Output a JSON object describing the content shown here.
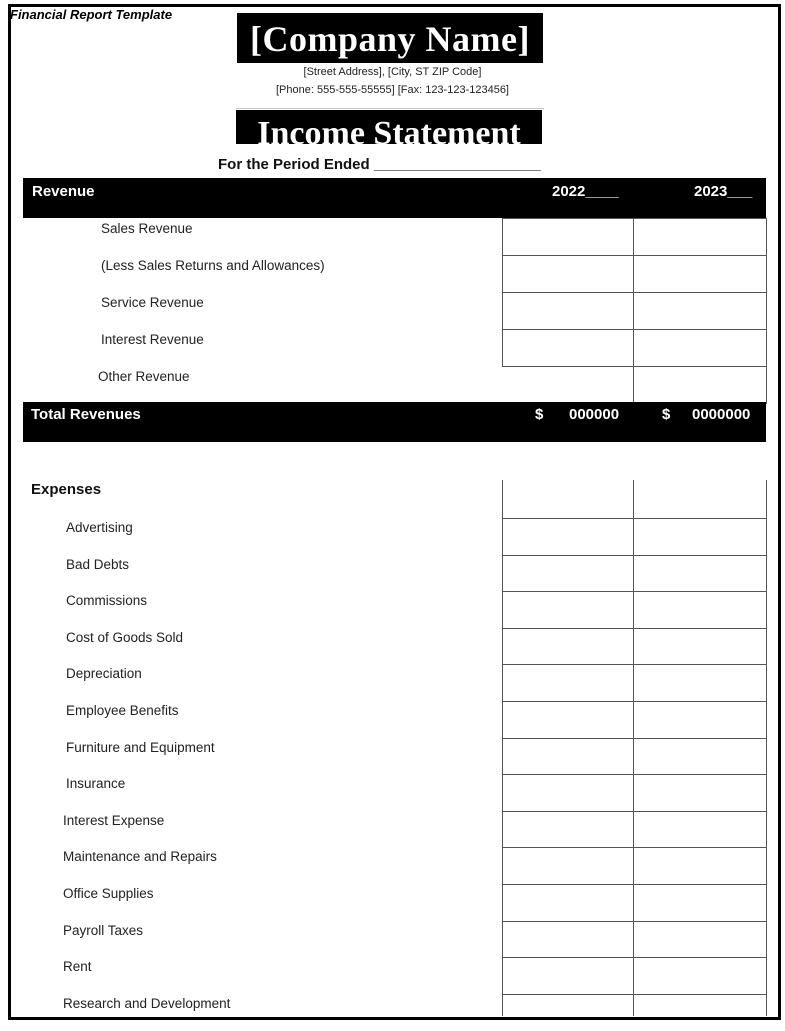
{
  "document": {
    "label": "Financial Report Template",
    "company_name": "[Company Name]",
    "address_line": "[Street Address], [City, ST ZIP Code]",
    "contact_line": "[Phone: 555-555-55555] [Fax: 123-123-123456]",
    "title": "Income Statement",
    "period_line": "For the Period Ended ____________________"
  },
  "revenue": {
    "header_label": "Revenue",
    "year1_label": "2022____",
    "year2_label": "2023___",
    "items": [
      {
        "label": "Sales Revenue",
        "year1": "",
        "year2": ""
      },
      {
        "label": "(Less Sales Returns and Allowances)",
        "year1": "",
        "year2": ""
      },
      {
        "label": "Service Revenue",
        "year1": "",
        "year2": ""
      },
      {
        "label": "Interest Revenue",
        "year1": "",
        "year2": ""
      },
      {
        "label": "Other Revenue",
        "year2": ""
      }
    ],
    "total": {
      "label": "Total Revenues",
      "currency": "$",
      "year1": "000000",
      "year2": "0000000"
    }
  },
  "expenses": {
    "header_label": "Expenses",
    "items": [
      {
        "label": "Advertising"
      },
      {
        "label": "Bad Debts"
      },
      {
        "label": "Commissions"
      },
      {
        "label": "Cost of Goods Sold"
      },
      {
        "label": "Depreciation"
      },
      {
        "label": "Employee Benefits"
      },
      {
        "label": "Furniture and Equipment"
      },
      {
        "label": "Insurance"
      },
      {
        "label": "Interest Expense"
      },
      {
        "label": "Maintenance and Repairs"
      },
      {
        "label": "Office Supplies"
      },
      {
        "label": "Payroll Taxes"
      },
      {
        "label": "Rent"
      },
      {
        "label": "Research and Development"
      }
    ]
  }
}
